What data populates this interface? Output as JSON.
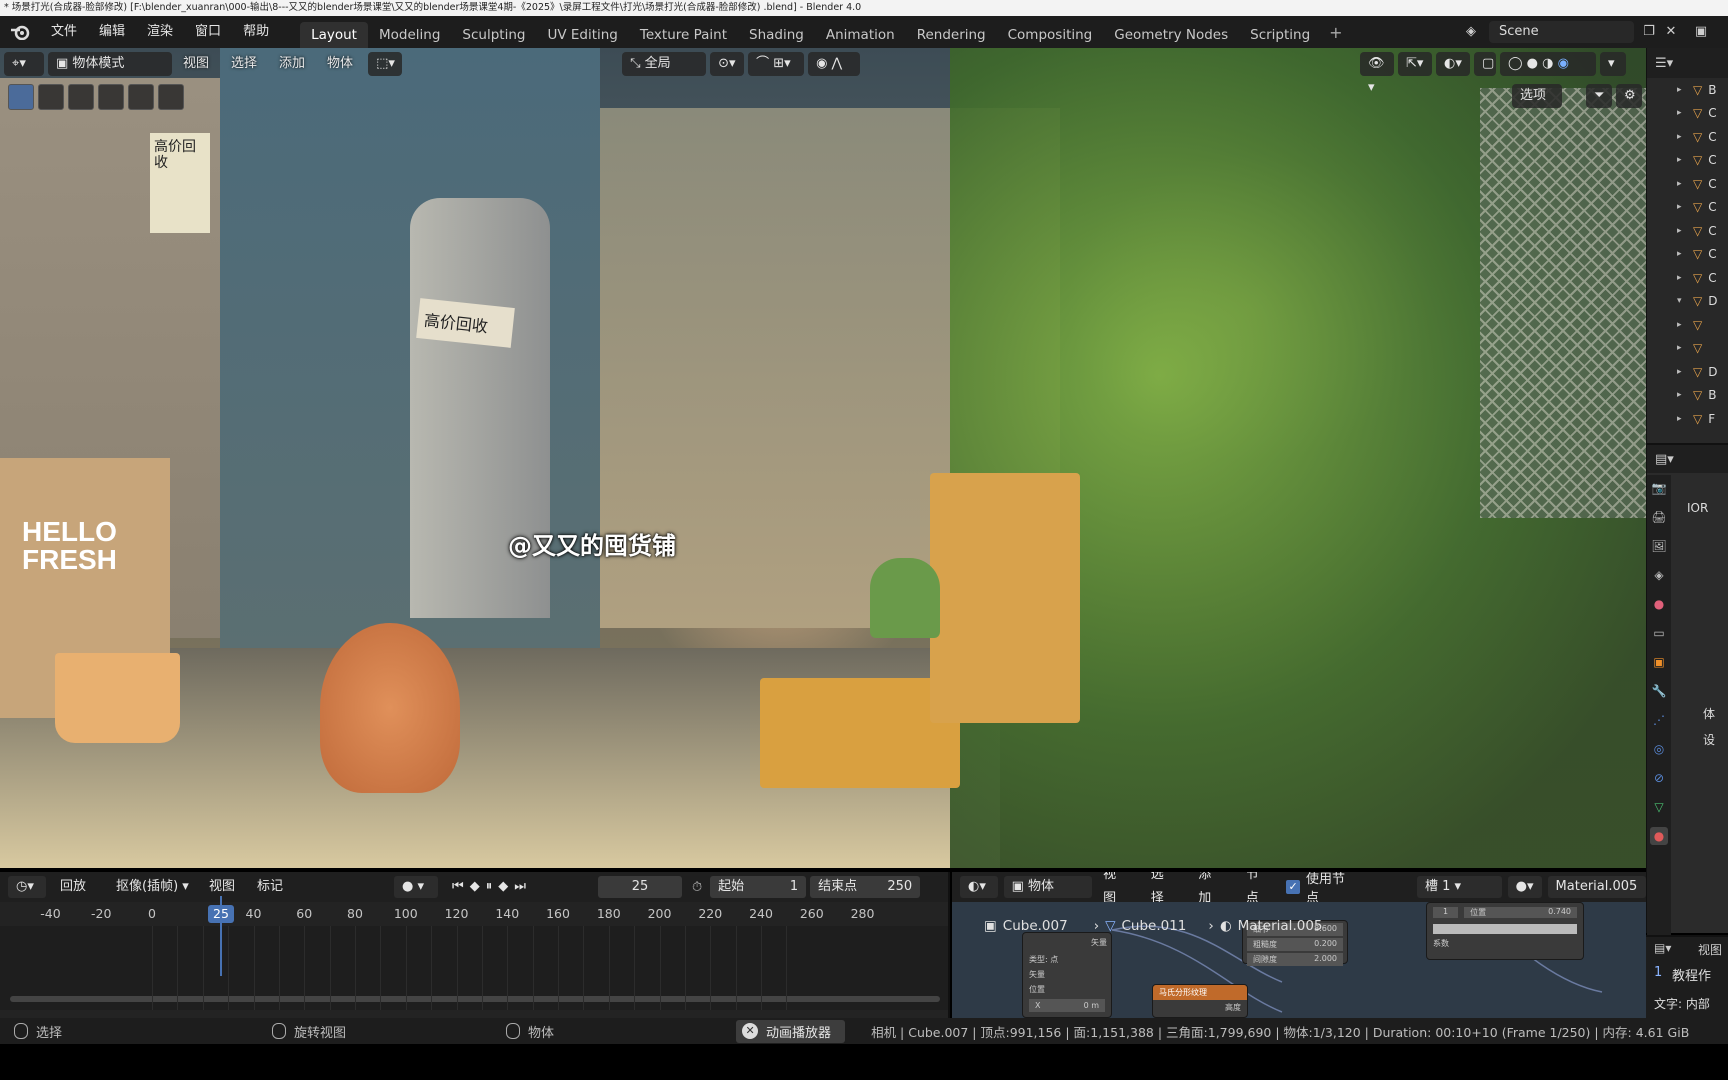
{
  "os_title": "* 场景打光(合成器-脸部修改)  [F:\\blender_xuanran\\000-输出\\8---又又的blender场景课堂\\又又的blender场景课堂4期-《2025》\\录屏工程文件\\打光\\场景打光(合成器-脸部修改) .blend] - Blender 4.0",
  "menu": [
    "文件",
    "编辑",
    "渲染",
    "窗口",
    "帮助"
  ],
  "workspaces": [
    "Layout",
    "Modeling",
    "Sculpting",
    "UV Editing",
    "Texture Paint",
    "Shading",
    "Animation",
    "Rendering",
    "Compositing",
    "Geometry Nodes",
    "Scripting"
  ],
  "active_workspace": "Layout",
  "scene_name": "Scene",
  "viewport": {
    "mode": "物体模式",
    "menus": [
      "视图",
      "选择",
      "添加",
      "物体"
    ],
    "orientation": "全局",
    "options_label": "选项",
    "watermark": "@又又的囤货铺",
    "sign_text_1": "高价回收",
    "sign_text_2": "高价回收",
    "box_text": "HELLO FRESH"
  },
  "outliner": {
    "letters": [
      "B",
      "C",
      "C",
      "C",
      "C",
      "C",
      "C",
      "C",
      "C",
      "D",
      "",
      "",
      "D",
      "B",
      "F"
    ]
  },
  "properties": {
    "ior_label": "IOR",
    "side_labels": [
      "体",
      "设"
    ],
    "view_label": "视图",
    "bottom_label_1": "教程作",
    "bottom_label_2": "文字: 内部",
    "line_number": "1"
  },
  "timeline": {
    "playback": "回放",
    "keying": "抠像(插帧)",
    "view": "视图",
    "marker": "标记",
    "current_frame": "25",
    "start_label": "起始",
    "start": "1",
    "end_label": "结束点",
    "end": "250",
    "ruler": [
      "-40",
      "-20",
      "0",
      "20",
      "40",
      "60",
      "80",
      "100",
      "120",
      "140",
      "160",
      "180",
      "200",
      "220",
      "240",
      "260",
      "280"
    ]
  },
  "node_editor": {
    "type": "物体",
    "menus": [
      "视图",
      "选择",
      "添加",
      "节点"
    ],
    "use_nodes_label": "使用节点",
    "slot": "槽 1",
    "material": "Material.005",
    "breadcrumb": [
      "Cube.007",
      "Cube.011",
      "Material.005"
    ],
    "node1_rows": [
      "矢量",
      "类型:",
      "点",
      "矢量",
      "位置",
      "X",
      "0 m"
    ],
    "node2_rows": [
      "细节",
      "8.600",
      "粗糙度",
      "0.200",
      "间隙度",
      "2.000"
    ],
    "node3_title": "马氏分形纹理",
    "node3_out": "高度",
    "node4_rows": [
      "1",
      "位置",
      "0.740",
      "系数"
    ]
  },
  "status": {
    "select": "选择",
    "rotate": "旋转视图",
    "object": "物体",
    "anim_player": "动画播放器",
    "stats": "相机 | Cube.007 | 顶点:991,156 | 面:1,151,388 | 三角面:1,799,690 | 物体:1/3,120 | Duration: 00:10+10 (Frame 1/250) | 内存: 4.61 GiB"
  },
  "colors": {
    "accent": "#4772b3",
    "topbar": "#1d1d1d",
    "panel": "#2b2b2b",
    "outliner_icon": "#e3a14b"
  }
}
